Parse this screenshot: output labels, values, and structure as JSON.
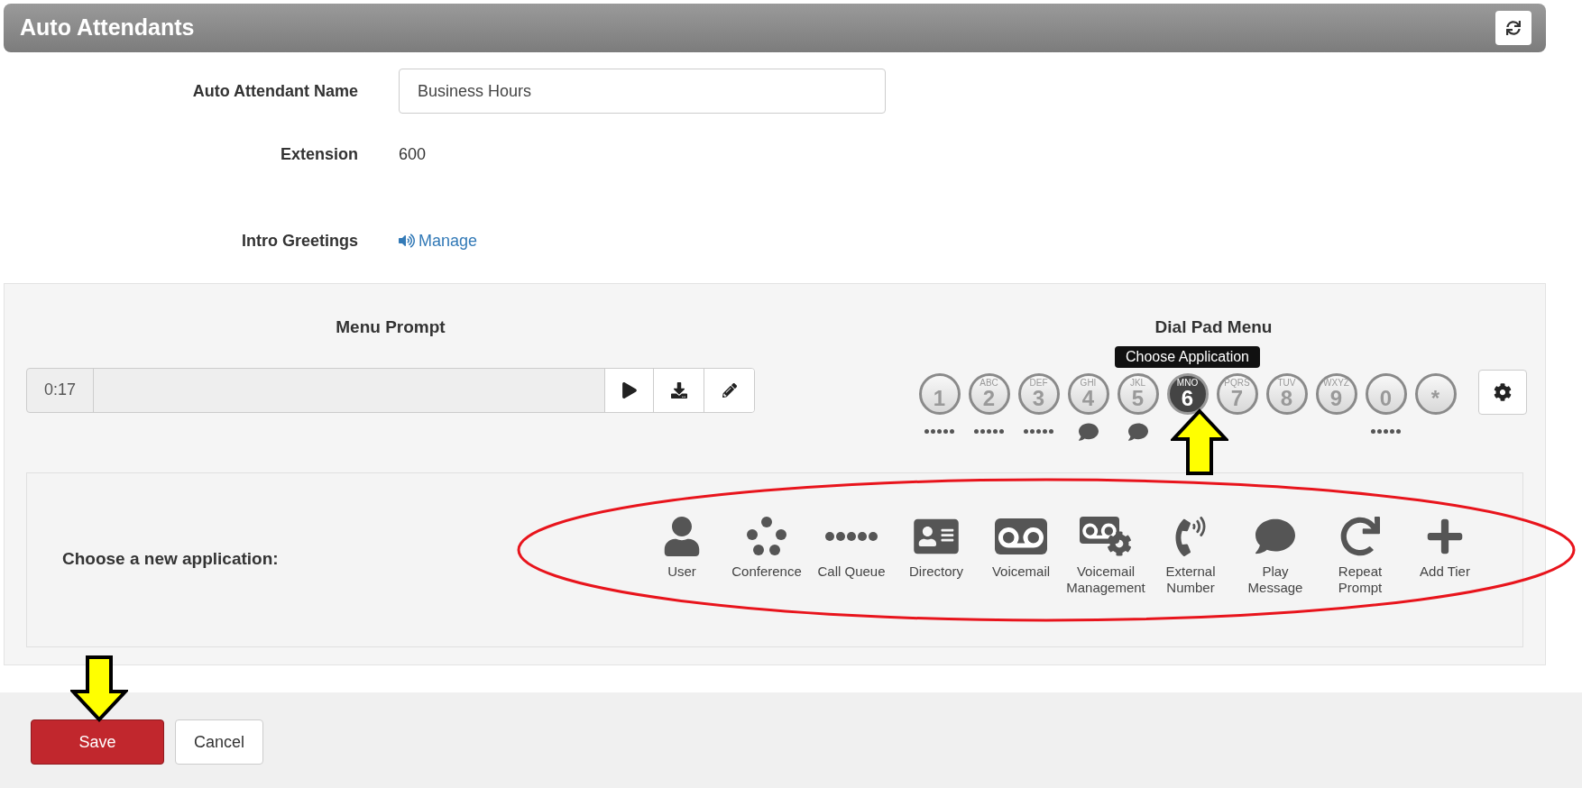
{
  "header": {
    "title": "Auto Attendants"
  },
  "form": [
    {
      "kind": "input",
      "label": "Auto Attendant Name",
      "value": "Business Hours"
    },
    {
      "kind": "text",
      "label": "Extension",
      "value": "600"
    },
    {
      "kind": "link",
      "label": "Intro Greetings",
      "value": "Manage"
    }
  ],
  "menu_prompt": {
    "title": "Menu Prompt",
    "time": "0:17"
  },
  "dial_pad": {
    "title": "Dial Pad Menu",
    "tooltip": "Choose Application",
    "keys": [
      {
        "kind": "dots",
        "digit": "1",
        "selected": false
      },
      {
        "kind": "dots",
        "digit": "2",
        "letters": "ABC",
        "selected": false
      },
      {
        "kind": "dots",
        "digit": "3",
        "letters": "DEF",
        "selected": false
      },
      {
        "kind": "message",
        "digit": "4",
        "letters": "GHI",
        "selected": false
      },
      {
        "kind": "message",
        "digit": "5",
        "letters": "JKL",
        "selected": false
      },
      {
        "kind": "plain",
        "digit": "6",
        "letters": "MNO",
        "selected": true
      },
      {
        "kind": "plain",
        "digit": "7",
        "letters": "PQRS",
        "selected": false
      },
      {
        "kind": "plain",
        "digit": "8",
        "letters": "TUV",
        "selected": false
      },
      {
        "kind": "plain",
        "digit": "9",
        "letters": "WXYZ",
        "selected": false
      },
      {
        "kind": "dots",
        "digit": "0",
        "selected": false
      },
      {
        "kind": "plain",
        "digit": "*",
        "selected": false
      }
    ]
  },
  "applications": {
    "label": "Choose a new application:",
    "items": [
      {
        "kind": "user",
        "label": "User"
      },
      {
        "kind": "conference",
        "label": "Conference"
      },
      {
        "kind": "queue",
        "label": "Call Queue"
      },
      {
        "kind": "directory",
        "label": "Directory"
      },
      {
        "kind": "voicemail",
        "label": "Voicemail"
      },
      {
        "kind": "vm_manage",
        "label": "Voicemail Management"
      },
      {
        "kind": "external",
        "label": "External Number"
      },
      {
        "kind": "message",
        "label": "Play Message"
      },
      {
        "kind": "repeat",
        "label": "Repeat Prompt"
      },
      {
        "kind": "tier",
        "label": "Add Tier"
      }
    ]
  },
  "footer": {
    "buttons": [
      {
        "kind": "primary",
        "label": "Save"
      },
      {
        "kind": "default",
        "label": "Cancel"
      }
    ]
  }
}
